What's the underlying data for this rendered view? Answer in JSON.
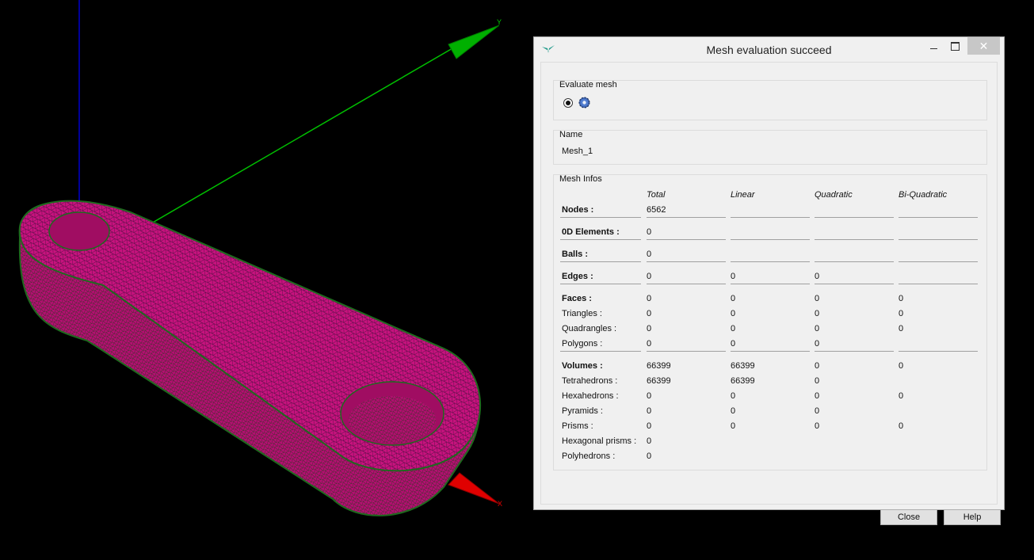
{
  "viewport": {
    "axis_y_label": "Y",
    "axis_x_label": "X",
    "colors": {
      "mesh": "#c8127e",
      "mesh_edge": "#1e6a1e",
      "axis_x": "#e00000",
      "axis_y": "#00c000",
      "axis_z": "#0000ff",
      "background": "#000000"
    }
  },
  "dialog": {
    "title": "Mesh evaluation succeed",
    "window_buttons": {
      "close": "✕"
    },
    "evaluate_group": {
      "title": "Evaluate mesh",
      "icon": "gear-icon",
      "selected": true
    },
    "name_group": {
      "title": "Name",
      "value": "Mesh_1"
    },
    "infos_group": {
      "title": "Mesh Infos",
      "columns": [
        "Total",
        "Linear",
        "Quadratic",
        "Bi-Quadratic"
      ],
      "rows": [
        {
          "label": "Nodes :",
          "bold": true,
          "cells": [
            "6562",
            "",
            "",
            ""
          ]
        },
        {
          "label": "0D Elements :",
          "bold": true,
          "cells": [
            "0",
            "",
            "",
            ""
          ]
        },
        {
          "label": "Balls :",
          "bold": true,
          "cells": [
            "0",
            "",
            "",
            ""
          ]
        },
        {
          "label": "Edges :",
          "bold": true,
          "cells": [
            "0",
            "0",
            "0",
            ""
          ]
        },
        {
          "label": "Faces :",
          "bold": true,
          "cells": [
            "0",
            "0",
            "0",
            "0"
          ]
        },
        {
          "label": "Triangles :",
          "bold": false,
          "cells": [
            "0",
            "0",
            "0",
            "0"
          ]
        },
        {
          "label": "Quadrangles :",
          "bold": false,
          "cells": [
            "0",
            "0",
            "0",
            "0"
          ]
        },
        {
          "label": "Polygons :",
          "bold": false,
          "cells": [
            "0",
            "0",
            "0",
            ""
          ]
        },
        {
          "label": "Volumes :",
          "bold": true,
          "cells": [
            "66399",
            "66399",
            "0",
            "0"
          ]
        },
        {
          "label": "Tetrahedrons :",
          "bold": false,
          "cells": [
            "66399",
            "66399",
            "0",
            ""
          ]
        },
        {
          "label": "Hexahedrons :",
          "bold": false,
          "cells": [
            "0",
            "0",
            "0",
            "0"
          ]
        },
        {
          "label": "Pyramids :",
          "bold": false,
          "cells": [
            "0",
            "0",
            "0",
            ""
          ]
        },
        {
          "label": "Prisms :",
          "bold": false,
          "cells": [
            "0",
            "0",
            "0",
            "0"
          ]
        },
        {
          "label": "Hexagonal prisms :",
          "bold": false,
          "cells": [
            "0",
            "",
            "",
            ""
          ]
        },
        {
          "label": "Polyhedrons :",
          "bold": false,
          "cells": [
            "0",
            "",
            "",
            ""
          ]
        }
      ]
    },
    "buttons": {
      "close": "Close",
      "help": "Help"
    }
  }
}
